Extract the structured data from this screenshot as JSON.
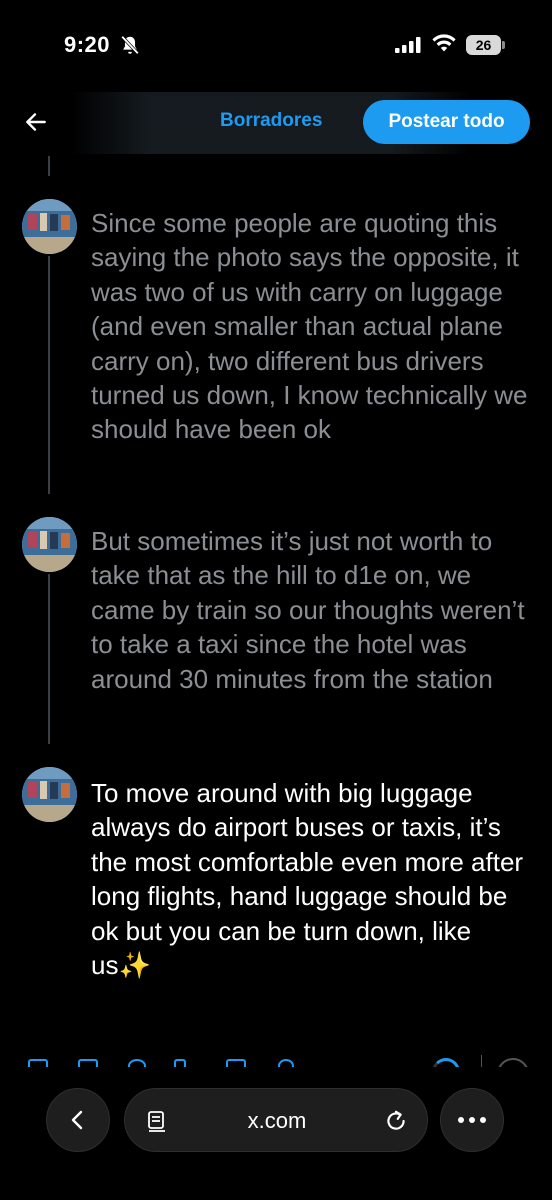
{
  "status_bar": {
    "time": "9:20",
    "battery": "26",
    "icons": [
      "bell-slash-icon",
      "cellular-signal-icon",
      "wifi-icon",
      "battery-icon"
    ]
  },
  "header": {
    "back_icon": "arrow-left-icon",
    "drafts_label": "Borradores",
    "post_all_label": "Postear todo",
    "accent_color": "#1d9bf0"
  },
  "thread": {
    "tweets": [
      {
        "text": "Since some people are quoting this saying the photo says the opposite, it was two of us with carry on luggage (and even smaller than actual plane carry on), two different bus drivers turned us down, I know technically we should have been ok",
        "state": "dim"
      },
      {
        "text": "But sometimes it’s just not worth to take that as the hill to d1e on, we came by train so our thoughts weren’t to take a taxi since the hotel was around 30 minutes from the station",
        "state": "dim"
      },
      {
        "text": "To move around with big luggage always do airport buses or taxis, it’s the most comfortable even more after long flights, hand luggage should be ok but you can be turn down, like us✨",
        "state": "active"
      }
    ]
  },
  "browser": {
    "url": "x.com",
    "icons": [
      "chevron-left-icon",
      "reader-mode-icon",
      "reload-icon",
      "more-icon"
    ]
  }
}
